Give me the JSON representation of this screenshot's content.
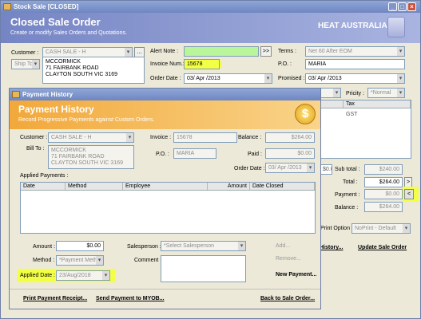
{
  "main_window": {
    "title": "Stock Sale [CLOSED]",
    "banner_title": "Closed Sale Order",
    "banner_subtitle": "Create or modify Sales Orders and Quotations.",
    "brand": "HEAT AUSTRALIA",
    "customer_label": "Customer :",
    "customer_value": "CASH SALE - H",
    "ship_to_value": "Ship To",
    "address": "MCCORMICK\n71 FAIRBANK ROAD\nCLAYTON SOUTH VIC 3169",
    "alert_note_label": "Alert Note :",
    "alert_note_value": "",
    "alert_btn": ">>",
    "invoice_num_label": "Invoice Num.:",
    "invoice_num_value": "15678",
    "order_date_label": "Order Date :",
    "order_date_value": "03/ Apr /2013",
    "terms_label": "Terms :",
    "terms_value": "Net 60 After EOM",
    "po_label": "P.O. :",
    "po_value": "MARIA",
    "promised_label": "Promised :",
    "promised_value": "03/ Apr /2013",
    "priority_label": "Pricity :",
    "priority_value": "*Normal",
    "grid_tax_header": "Tax",
    "grid_tax_value": "GST",
    "sub_total_label": "Sub total :",
    "sub_total_value": "$240.00",
    "total_label": "Total :",
    "total_value": "$264.00",
    "payment_label": "Payment :",
    "payment_value": "$0.00",
    "balance_label": "Balance :",
    "balance_value": "$264.00",
    "print_option_label": "Print Option :",
    "print_option_value": "NoPrint - Default",
    "history_link": "History...",
    "update_link": "Update Sale Order",
    "amount_partial": "$0.00"
  },
  "payment_window": {
    "title": "Payment History",
    "banner_title": "Payment History",
    "banner_subtitle": "Record Progressive Payments against Custom Orders.",
    "customer_label": "Customer :",
    "customer_value": "CASH SALE - H",
    "bill_to_label": "Bill To :",
    "bill_to_value": "MCCORMICK\n71 FAIRBANK ROAD\nCLAYTON SOUTH VIC 3169",
    "invoice_label": "Invoice :",
    "invoice_value": "15678",
    "po_label": "P.O. :",
    "po_value": "MARIA",
    "balance_label": "Balance :",
    "balance_value": "$264.00",
    "paid_label": "Paid :",
    "paid_value": "$0.00",
    "order_date_label": "Order Date :",
    "order_date_value": "03/ Apr /2013",
    "applied_payments_label": "Applied Payments :",
    "columns": [
      "Date",
      "Method",
      "Employee",
      "Amount",
      "Date Closed"
    ],
    "amount_label": "Amount :",
    "amount_value": "$0.00",
    "method_label": "Method :",
    "method_value": "*Payment Method...",
    "applied_date_label": "Applied Date :",
    "applied_date_value": "23/Aug/2018",
    "salesperson_label": "Salesperson :",
    "salesperson_value": "*Select Salesperson",
    "comment_label": "Comment :",
    "add_link": "Add...",
    "remove_link": "Remove...",
    "new_payment_link": "New Payment...",
    "print_receipt_link": "Print Payment Receipt...",
    "send_myob_link": "Send Payment to MYOB...",
    "back_link": "Back to Sale Order..."
  },
  "colors": {
    "banner": "#7584c4",
    "highlight": "#f2ff44",
    "alert_field": "#b9f59a"
  }
}
